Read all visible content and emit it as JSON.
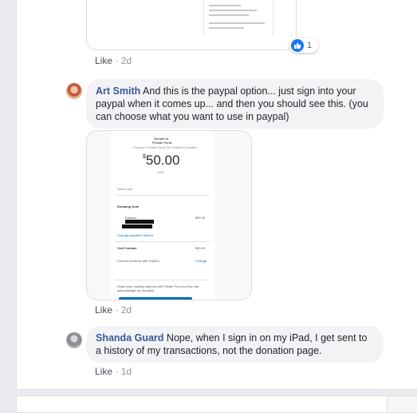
{
  "top_comment": {
    "like_label": "Like",
    "separator": "·",
    "age": "2d",
    "reaction_count": "1"
  },
  "comment1": {
    "author": "Art Smith",
    "text": "And this is the paypal option... just sign into your paypal when it comes up... and then you should see this. (you can choose what you want to use in paypal)",
    "like_label": "Like",
    "separator": "·",
    "age": "2d",
    "attachment": {
      "title": "Donate to",
      "subtitle": "Private Fund",
      "fund_line": "Purpose: Private Fund Tax Finished Donation",
      "amount_symbol": "$",
      "amount": "50.00",
      "currency": "USD",
      "add_note": "Add a note",
      "donating_from": "Donating from",
      "balance_label": "Balance",
      "balance_value": "$50.00",
      "change_method": "Change payment method",
      "you_donate": "You'll donate",
      "you_donate_value": "$50.00",
      "convert": "Convert currency with PayPal",
      "convert_action": "Change",
      "share_text": "Share your mailing address with Private Fund so they can acknowledge my donation"
    }
  },
  "comment2": {
    "author": "Shanda Guard",
    "text": "Nope, when I sign in on my iPad, I get sent to a history of my transactions, not the donation page.",
    "like_label": "Like",
    "separator": "·",
    "age": "1d"
  }
}
